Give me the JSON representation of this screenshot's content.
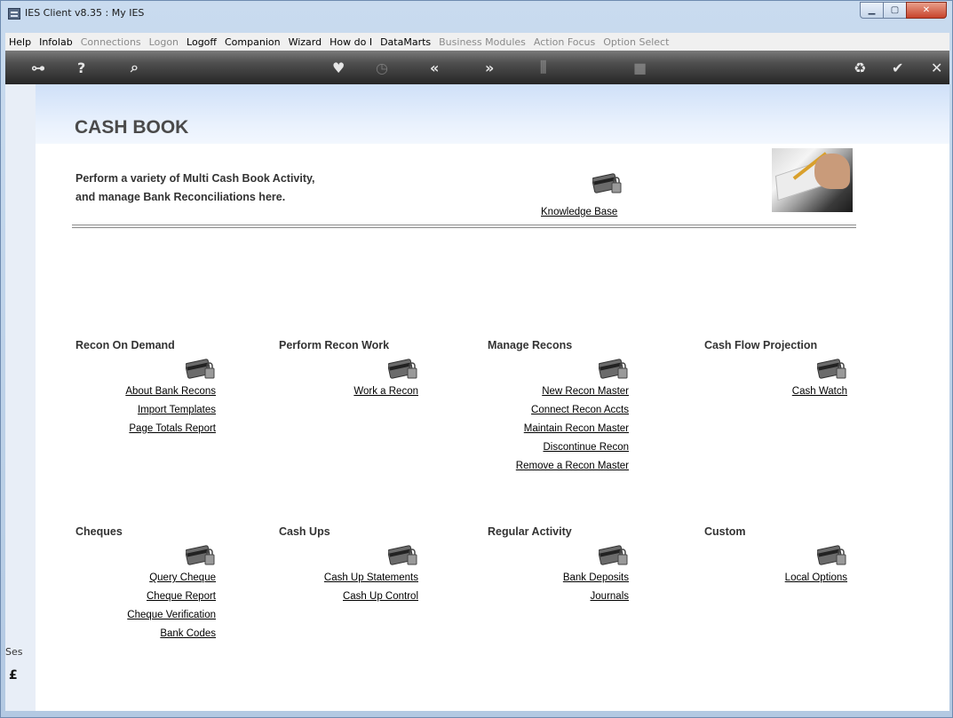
{
  "window": {
    "title": "IES Client v8.35 : My IES"
  },
  "menu": [
    {
      "label": "Help",
      "enabled": true
    },
    {
      "label": "Infolab",
      "enabled": true
    },
    {
      "label": "Connections",
      "enabled": false
    },
    {
      "label": "Logon",
      "enabled": false
    },
    {
      "label": "Logoff",
      "enabled": true
    },
    {
      "label": "Companion",
      "enabled": true
    },
    {
      "label": "Wizard",
      "enabled": true
    },
    {
      "label": "How do I",
      "enabled": true
    },
    {
      "label": "DataMarts",
      "enabled": true
    },
    {
      "label": "Business Modules",
      "enabled": false
    },
    {
      "label": "Action Focus",
      "enabled": false
    },
    {
      "label": "Option Select",
      "enabled": false
    }
  ],
  "toolbar": [
    {
      "name": "key-icon",
      "glyph": "⊶",
      "dim": false
    },
    {
      "name": "help-icon",
      "glyph": "?",
      "dim": false
    },
    {
      "name": "search-icon",
      "glyph": "⌕",
      "dim": false
    },
    {
      "name": "heart-icon",
      "glyph": "♥",
      "dim": false
    },
    {
      "name": "clock-icon",
      "glyph": "◷",
      "dim": true
    },
    {
      "name": "rewind-icon",
      "glyph": "«",
      "dim": false
    },
    {
      "name": "forward-icon",
      "glyph": "»",
      "dim": false
    },
    {
      "name": "columns-icon",
      "glyph": "⫼",
      "dim": true
    },
    {
      "name": "stop-icon",
      "glyph": "■",
      "dim": true
    },
    {
      "name": "recycle-icon",
      "glyph": "♻",
      "dim": false
    },
    {
      "name": "check-icon",
      "glyph": "✔",
      "dim": false
    },
    {
      "name": "close-icon",
      "glyph": "✕",
      "dim": false
    }
  ],
  "page": {
    "title": "CASH BOOK",
    "intro_line1": "Perform a variety of Multi Cash Book Activity,",
    "intro_line2": "and manage Bank Reconciliations here.",
    "knowledge_base": "Knowledge Base"
  },
  "sections": [
    {
      "title": "Recon On Demand",
      "links": [
        "About Bank Recons",
        "Import Templates",
        "Page Totals Report"
      ]
    },
    {
      "title": "Perform Recon Work",
      "links": [
        "Work a Recon"
      ]
    },
    {
      "title": "Manage Recons",
      "links": [
        "New Recon Master",
        "Connect Recon Accts",
        "Maintain Recon Master",
        "Discontinue Recon",
        "Remove a Recon Master"
      ]
    },
    {
      "title": "Cash Flow Projection",
      "links": [
        "Cash Watch"
      ]
    },
    {
      "title": "Cheques",
      "links": [
        "Query Cheque",
        "Cheque Report",
        "Cheque Verification",
        "Bank Codes"
      ]
    },
    {
      "title": "Cash Ups",
      "links": [
        "Cash Up Statements",
        "Cash Up Control"
      ]
    },
    {
      "title": "Regular Activity",
      "links": [
        "Bank Deposits",
        "Journals"
      ]
    },
    {
      "title": "Custom",
      "links": [
        "Local Options"
      ]
    }
  ],
  "session": {
    "label": "Ses"
  }
}
